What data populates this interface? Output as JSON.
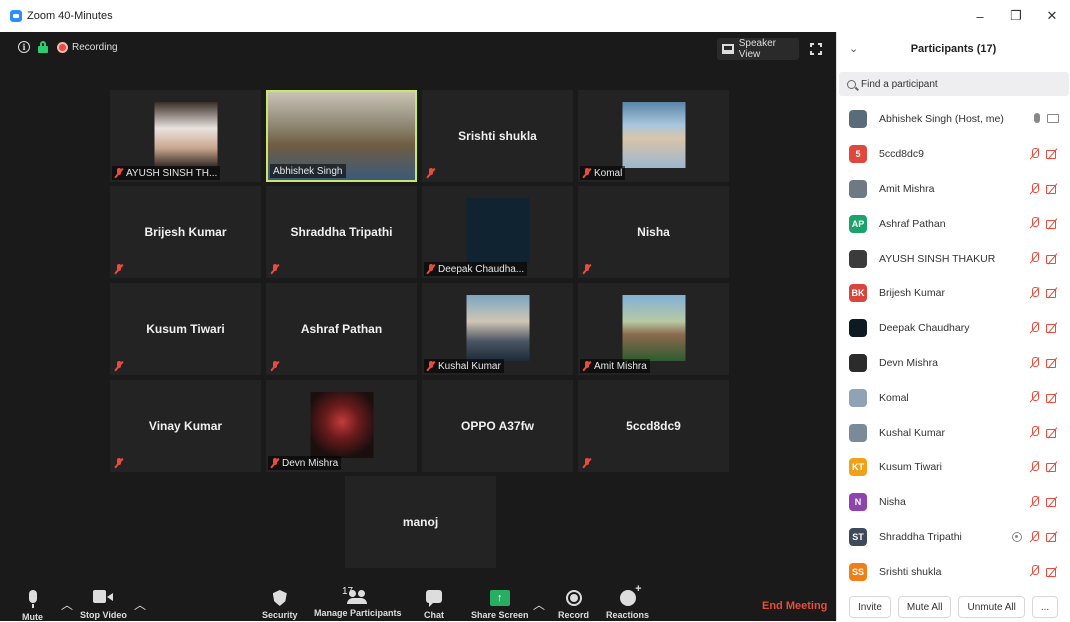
{
  "window": {
    "title": "Zoom 40-Minutes",
    "minimize": "–",
    "restore": "❐",
    "close": "✕"
  },
  "topbar": {
    "recording_label": "Recording",
    "speaker_view_label": "Speaker View"
  },
  "tiles": [
    {
      "name": "AYUSH SINSH TH...",
      "label": "AYUSH SINSH TH...",
      "photo": true,
      "muted": true
    },
    {
      "name": "Abhishek Singh",
      "label": "Abhishek Singh",
      "photo": true,
      "muted": false,
      "active": true
    },
    {
      "name": "Srishti shukla",
      "label": "",
      "photo": false,
      "muted": true
    },
    {
      "name": "Komal",
      "label": "Komal",
      "photo": true,
      "muted": true
    },
    {
      "name": "Brijesh Kumar",
      "label": "",
      "photo": false,
      "muted": true
    },
    {
      "name": "Shraddha Tripathi",
      "label": "",
      "photo": false,
      "muted": true
    },
    {
      "name": "Deepak Chaudha...",
      "label": "Deepak Chaudha...",
      "photo": true,
      "muted": true
    },
    {
      "name": "Nisha",
      "label": "",
      "photo": false,
      "muted": true
    },
    {
      "name": "Kusum Tiwari",
      "label": "",
      "photo": false,
      "muted": true
    },
    {
      "name": "Ashraf Pathan",
      "label": "",
      "photo": false,
      "muted": true
    },
    {
      "name": "Kushal Kumar",
      "label": "Kushal Kumar",
      "photo": true,
      "muted": true
    },
    {
      "name": "Amit Mishra",
      "label": "Amit Mishra",
      "photo": true,
      "muted": true
    },
    {
      "name": "Vinay Kumar",
      "label": "",
      "photo": false,
      "muted": true
    },
    {
      "name": "Devn Mishra",
      "label": "Devn Mishra",
      "photo": true,
      "muted": true
    },
    {
      "name": "OPPO A37fw",
      "label": "",
      "photo": false,
      "muted": false
    },
    {
      "name": "5ccd8dc9",
      "label": "",
      "photo": false,
      "muted": true
    },
    {
      "name": "manoj",
      "label": "",
      "photo": false,
      "muted": false
    }
  ],
  "toolbar": {
    "mute_label": "Mute",
    "stop_video_label": "Stop Video",
    "security_label": "Security",
    "manage_participants_label": "Manage Participants",
    "participant_count": "17",
    "chat_label": "Chat",
    "share_screen_label": "Share Screen",
    "record_label": "Record",
    "reactions_label": "Reactions",
    "end_meeting_label": "End Meeting"
  },
  "panel": {
    "title": "Participants (17)",
    "search_placeholder": "Find a participant",
    "participants": [
      {
        "name": "Abhishek Singh (Host, me)",
        "initials": "",
        "color": "#5a6b7a",
        "photo": true,
        "audio": "on"
      },
      {
        "name": "5ccd8dc9",
        "initials": "5",
        "color": "#e0483e",
        "photo": false,
        "audio": "muted"
      },
      {
        "name": "Amit Mishra",
        "initials": "",
        "color": "#6d7a86",
        "photo": true,
        "audio": "muted"
      },
      {
        "name": "Ashraf Pathan",
        "initials": "AP",
        "color": "#1aa36b",
        "photo": false,
        "audio": "muted"
      },
      {
        "name": "AYUSH SINSH THAKUR",
        "initials": "",
        "color": "#3b3b3b",
        "photo": true,
        "audio": "muted"
      },
      {
        "name": "Brijesh Kumar",
        "initials": "BK",
        "color": "#d9453d",
        "photo": false,
        "audio": "muted"
      },
      {
        "name": "Deepak Chaudhary",
        "initials": "",
        "color": "#0d1a22",
        "photo": true,
        "audio": "muted"
      },
      {
        "name": "Devn Mishra",
        "initials": "",
        "color": "#2b2b2b",
        "photo": true,
        "audio": "muted"
      },
      {
        "name": "Komal",
        "initials": "",
        "color": "#8fa3b5",
        "photo": true,
        "audio": "muted"
      },
      {
        "name": "Kushal Kumar",
        "initials": "",
        "color": "#7b8a99",
        "photo": true,
        "audio": "muted"
      },
      {
        "name": "Kusum Tiwari",
        "initials": "KT",
        "color": "#f0a11a",
        "photo": false,
        "audio": "muted"
      },
      {
        "name": "Nisha",
        "initials": "N",
        "color": "#8e44ad",
        "photo": false,
        "audio": "muted"
      },
      {
        "name": "Shraddha Tripathi",
        "initials": "ST",
        "color": "#3e4a5c",
        "photo": false,
        "audio": "muted",
        "extra": true
      },
      {
        "name": "Srishti shukla",
        "initials": "SS",
        "color": "#f07f1a",
        "photo": false,
        "audio": "muted"
      }
    ],
    "invite_label": "Invite",
    "mute_all_label": "Mute All",
    "unmute_all_label": "Unmute All",
    "more_label": "..."
  }
}
